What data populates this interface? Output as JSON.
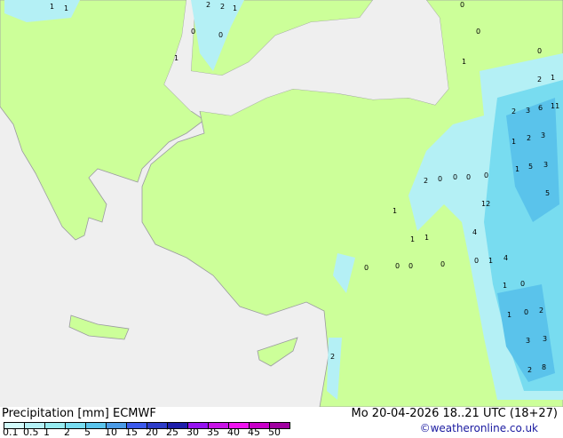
{
  "title": "Precipitation [mm]",
  "model": "ECMWF",
  "datetime": "Mo 20-04-2026 18..21 UTC (18+27)",
  "credit": "©weatheronline.co.uk",
  "legend": {
    "ticks": [
      "0.1",
      "0.5",
      "1",
      "2",
      "5",
      "10",
      "15",
      "20",
      "25",
      "30",
      "35",
      "40",
      "45",
      "50"
    ],
    "colors": [
      "#d2fafa",
      "#b4f0f5",
      "#96ebf0",
      "#78dcf0",
      "#5ac3eb",
      "#4b9be6",
      "#3c5aeb",
      "#2d3cc8",
      "#1e1eaa",
      "#9614f0",
      "#c814e6",
      "#f014f0",
      "#c800c8",
      "#a000a0"
    ]
  },
  "map": {
    "land_color": "#ccff99",
    "sea_color": "#efefef",
    "rain_light": "#b4f0f5",
    "rain_mid": "#5ac3eb",
    "rain_heavy": "#4b9be6",
    "labels": [
      "1",
      "1",
      "2",
      "2",
      "1",
      "0",
      "0",
      "1",
      "0",
      "1",
      "0",
      "1",
      "0",
      "2",
      "1",
      "3",
      "6",
      "11",
      "1",
      "2",
      "3",
      "1",
      "5",
      "3",
      "5",
      "2",
      "0",
      "0",
      "0",
      "0",
      "12",
      "1",
      "1",
      "1",
      "4",
      "0",
      "0",
      "0",
      "0",
      "1",
      "4",
      "0",
      "1",
      "0",
      "2",
      "1",
      "3",
      "3",
      "2",
      "8",
      "2"
    ]
  }
}
